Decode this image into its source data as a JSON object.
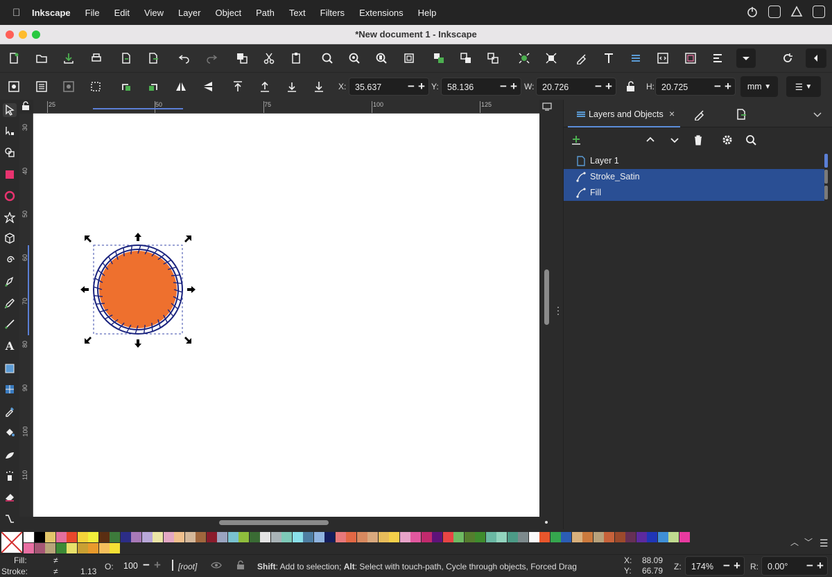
{
  "menu": {
    "app_name": "Inkscape",
    "items": [
      "File",
      "Edit",
      "View",
      "Layer",
      "Object",
      "Path",
      "Text",
      "Filters",
      "Extensions",
      "Help"
    ]
  },
  "window": {
    "title": "*New document 1 - Inkscape"
  },
  "controls": {
    "x_label": "X:",
    "x_value": "35.637",
    "y_label": "Y:",
    "y_value": "58.136",
    "w_label": "W:",
    "w_value": "20.726",
    "h_label": "H:",
    "h_value": "20.725",
    "unit": "mm"
  },
  "ruler": {
    "h_labels": [
      "25",
      "50",
      "75",
      "100",
      "125"
    ],
    "v_labels": [
      "30",
      "40",
      "50",
      "60",
      "70",
      "80",
      "90",
      "100",
      "110"
    ]
  },
  "dock": {
    "active_tab": "Layers and Objects",
    "layers": [
      {
        "name": "Layer 1",
        "selected": false
      },
      {
        "name": "Stroke_Satin",
        "selected": true
      },
      {
        "name": "Fill",
        "selected": true
      }
    ]
  },
  "canvas_object": {
    "fill_color": "#ee702e",
    "stroke_color": "#1a237e"
  },
  "status": {
    "fill_label": "Fill:",
    "fill_value": "≠",
    "stroke_label": "Stroke:",
    "stroke_value": "≠",
    "stroke_width": "1.13",
    "opacity_label": "O:",
    "opacity_value": "100",
    "layer": "[root]",
    "message_shift": "Shift",
    "message_shift_rest": ": Add to selection; ",
    "message_alt": "Alt",
    "message_alt_rest": ": Select with touch-path, Cycle through objects, Forced Drag",
    "cursor_x_label": "X:",
    "cursor_x": "88.09",
    "cursor_y_label": "Y:",
    "cursor_y": "66.79",
    "zoom_label": "Z:",
    "zoom": "174%",
    "rotation_label": "R:",
    "rotation": "0.00°"
  },
  "palette_colors": [
    "#ffffff",
    "#000000",
    "#e2c66a",
    "#e36f9e",
    "#e8472c",
    "#f5d33a",
    "#f2ef3b",
    "#5a2e12",
    "#3d7a3b",
    "#2c2d86",
    "#a879b8",
    "#b9a8d9",
    "#ebe5a6",
    "#e3a8c4",
    "#f0c08d",
    "#d4b89a",
    "#a0673d",
    "#8a1c2c",
    "#9aa4c0",
    "#79c1cf",
    "#8fbd3c",
    "#3a6b34",
    "#e3e3e3",
    "#a9b3b7",
    "#7ec9b8",
    "#8ae1ea",
    "#4e7ea2",
    "#8fb4e0",
    "#141d5c",
    "#e8787b",
    "#e36845",
    "#d8895f",
    "#d9a97e",
    "#e8bc5a",
    "#f5d04a",
    "#e8a3c9",
    "#e2589f",
    "#c22a6d",
    "#5e137a",
    "#e84545",
    "#6fbb63",
    "#557e2e",
    "#3f8c2e",
    "#6ab8a3",
    "#92d4be",
    "#4c9a86",
    "#7d8a8c",
    "#fafafa",
    "#e8562c",
    "#35a64e",
    "#2b5db5",
    "#d9b07c",
    "#cc7a3d",
    "#b8a27c",
    "#c8623a",
    "#9c4a2c",
    "#663055",
    "#5d2a9f",
    "#2036b7",
    "#3f8fd6",
    "#c0da8f",
    "#e83aa0"
  ],
  "palette_colors_row2": [
    "#e86fa3",
    "#a55675",
    "#b7a47a",
    "#3c8a36",
    "#e8e06a",
    "#c9a032",
    "#e89a2c",
    "#f5bf5c",
    "#f4e035"
  ]
}
